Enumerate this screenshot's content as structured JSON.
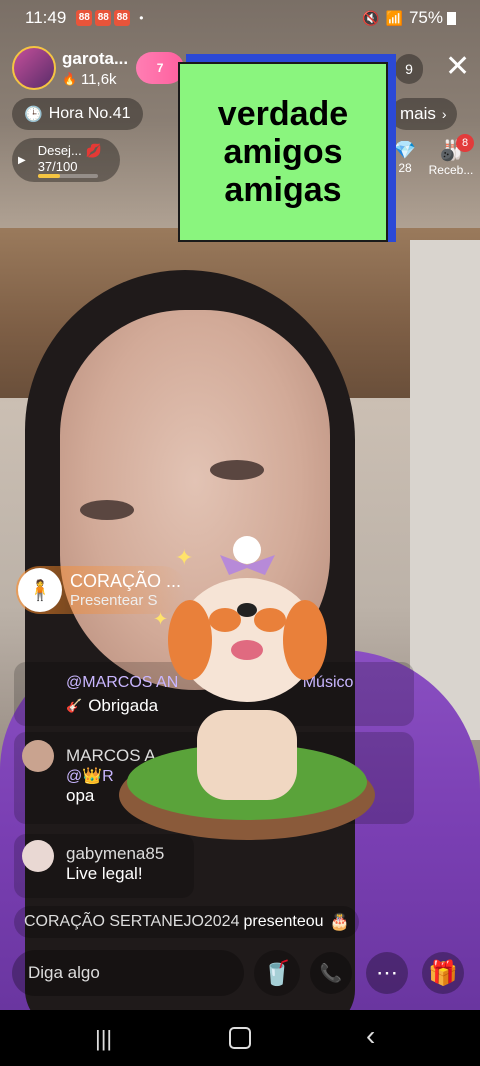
{
  "status_bar": {
    "time": "11:49",
    "dot": "•",
    "battery": "75%",
    "app_icons": [
      "88",
      "88",
      "88"
    ]
  },
  "host": {
    "name": "garota...",
    "likes": "11,6k",
    "follow_badge": "7"
  },
  "top_right": {
    "viewer_count": "9"
  },
  "hour_badge": {
    "label": "Hora No.41"
  },
  "more_link": {
    "label": "mais"
  },
  "desire": {
    "label": "Desej...",
    "progress_text": "37/100",
    "progress": 0.37
  },
  "right_items": {
    "timer": "28",
    "receive_label": "Receb...",
    "receive_badge": "8"
  },
  "sign": {
    "lines": [
      "verdade",
      "amigos",
      "amigas"
    ]
  },
  "gift_popup": {
    "name": "CORAÇÃO ...",
    "action": "Presentear S"
  },
  "chat": [
    {
      "user": "@MARCOS AN",
      "suffix": "Músico",
      "text": "Obrigada"
    },
    {
      "user": "MARCOS A",
      "mention": "@👑R",
      "text": "opa"
    },
    {
      "user": "gabymena85",
      "text": "Live legal!"
    }
  ],
  "gift_banner": {
    "user": "CORAÇÃO SERTANEJO2024",
    "action": "presenteou"
  },
  "input": {
    "placeholder": "Diga algo"
  },
  "colors": {
    "accent_pink": "#ff5f9e",
    "sign_green": "#8af57e",
    "sign_blue": "#2b49d6",
    "shirt": "#7a3fb3"
  }
}
